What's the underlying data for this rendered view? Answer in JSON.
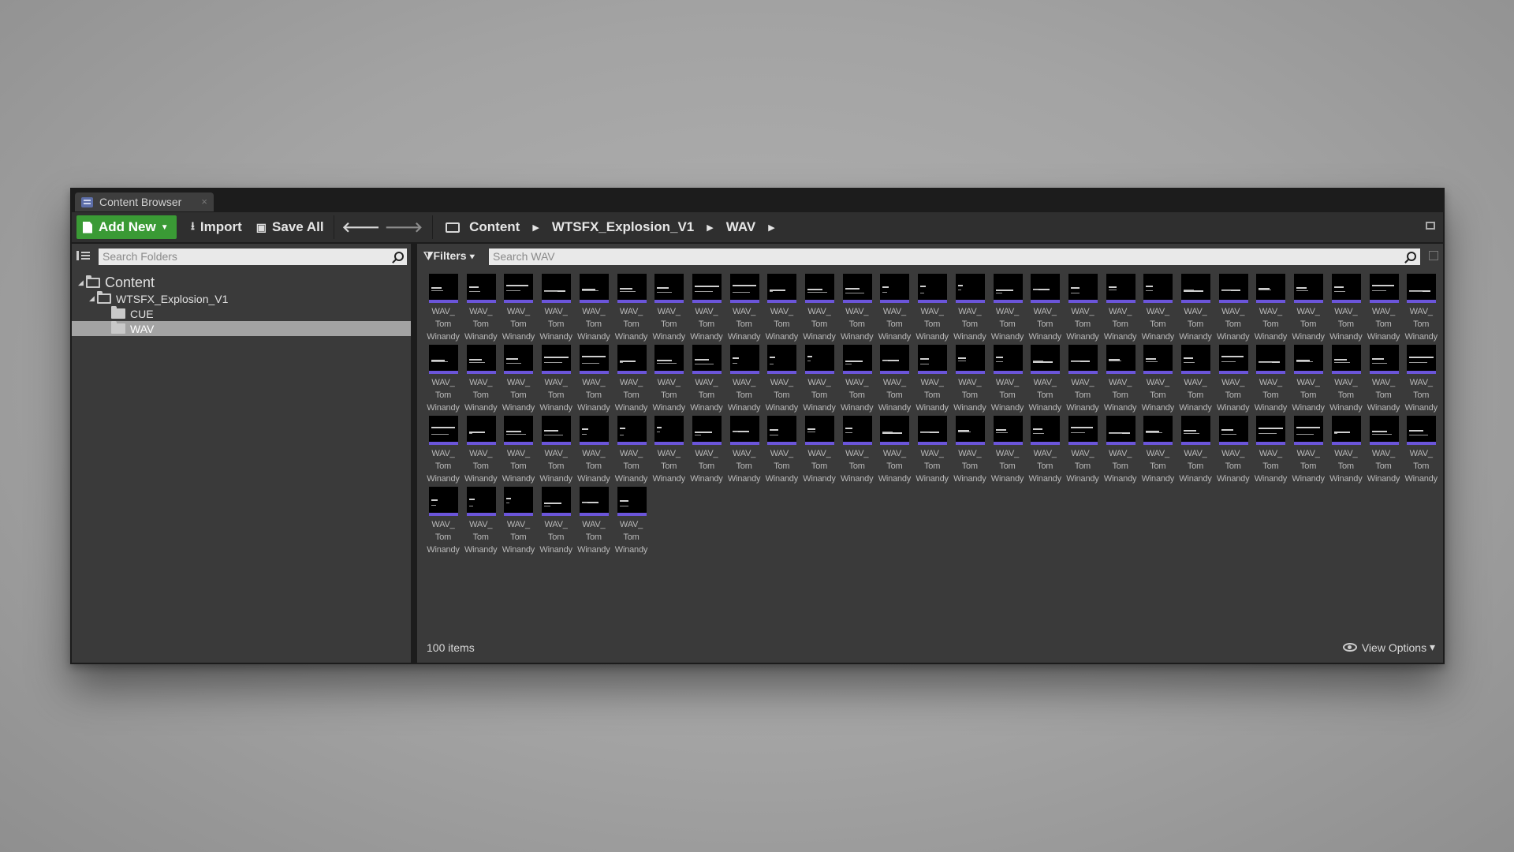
{
  "tab": {
    "title": "Content Browser",
    "close": "×"
  },
  "toolbar": {
    "add_new": "Add New",
    "import": "Import",
    "save_all": "Save All",
    "breadcrumbs": [
      "Content",
      "WTSFX_Explosion_V1",
      "WAV"
    ]
  },
  "sources": {
    "search_placeholder": "Search Folders",
    "tree": [
      {
        "label": "Content",
        "depth": 0,
        "expanded": true,
        "selected": false
      },
      {
        "label": "WTSFX_Explosion_V1",
        "depth": 1,
        "expanded": true,
        "selected": false
      },
      {
        "label": "CUE",
        "depth": 2,
        "expanded": false,
        "selected": false
      },
      {
        "label": "WAV",
        "depth": 2,
        "expanded": false,
        "selected": true
      }
    ]
  },
  "assets_panel": {
    "filters_label": "Filters",
    "search_placeholder": "Search WAV",
    "asset_label_lines": [
      "WAV_",
      "Tom",
      "Winandy"
    ],
    "asset_count_shown": 87,
    "item_count_text": "100 items",
    "view_options": "View Options"
  },
  "colors": {
    "accent_bar": "#6b55d9",
    "add_new_green": "#3a9a35",
    "selected_row": "#a3a3a3"
  }
}
